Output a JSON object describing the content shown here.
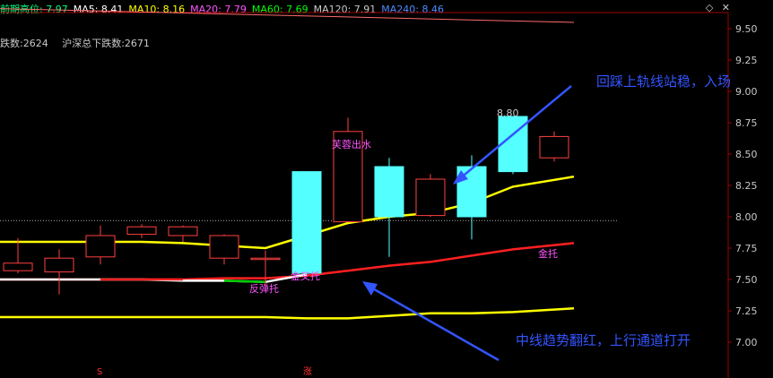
{
  "header": {
    "items": [
      {
        "label": "前期高位: 7.97",
        "color": "#00ff7f"
      },
      {
        "label": "MA5: 8.41",
        "color": "#ffffff"
      },
      {
        "label": "MA10: 8.16",
        "color": "#ffff00"
      },
      {
        "label": "MA20: 7.79",
        "color": "#ff55ff"
      },
      {
        "label": "MA60: 7.69",
        "color": "#00ff00"
      },
      {
        "label": "MA120: 7.91",
        "color": "#c8c8c8"
      },
      {
        "label": "MA240: 8.46",
        "color": "#4a8cff"
      }
    ],
    "icons": [
      "diamond-icon",
      "close-icon"
    ]
  },
  "subheader": {
    "left": "跌数:2624",
    "right": "沪深总下跌数:2671"
  },
  "chart_data": {
    "type": "candlestick",
    "ylim": [
      6.8,
      9.6
    ],
    "y_ticks": [
      "9.50",
      "9.25",
      "9.00",
      "8.75",
      "8.50",
      "8.25",
      "8.00",
      "7.75",
      "7.50",
      "7.25",
      "7.00"
    ],
    "candles": [
      {
        "open": 7.57,
        "close": 7.63,
        "high": 7.83,
        "low": 7.55
      },
      {
        "open": 7.56,
        "close": 7.67,
        "high": 7.74,
        "low": 7.38
      },
      {
        "open": 7.68,
        "close": 7.85,
        "high": 7.93,
        "low": 7.62
      },
      {
        "open": 7.86,
        "close": 7.92,
        "high": 7.94,
        "low": 7.83
      },
      {
        "open": 7.85,
        "close": 7.92,
        "high": 7.93,
        "low": 7.8
      },
      {
        "open": 7.67,
        "close": 7.85,
        "high": 7.86,
        "low": 7.62
      },
      {
        "open": 7.67,
        "close": 7.67,
        "high": 7.73,
        "low": 7.45
      },
      {
        "open": 8.36,
        "close": 7.55,
        "high": 8.36,
        "low": 7.55
      },
      {
        "open": 7.96,
        "close": 8.68,
        "high": 8.79,
        "low": 7.96
      },
      {
        "open": 8.4,
        "close": 8.0,
        "high": 8.47,
        "low": 7.68
      },
      {
        "open": 8.01,
        "close": 8.3,
        "high": 8.34,
        "low": 8.0
      },
      {
        "open": 8.4,
        "close": 8.0,
        "high": 8.49,
        "low": 7.82
      },
      {
        "open": 8.8,
        "close": 8.36,
        "high": 8.8,
        "low": 8.34
      },
      {
        "open": 8.47,
        "close": 8.64,
        "high": 8.68,
        "low": 8.44
      }
    ],
    "series": [
      {
        "color": "#ffff00",
        "values": [
          7.8,
          7.8,
          7.8,
          7.8,
          7.79,
          7.77,
          7.75,
          7.85,
          7.95,
          8.0,
          8.03,
          8.11,
          8.24,
          8.32
        ]
      },
      {
        "color": "#ff2020",
        "values": [
          7.5,
          7.5,
          7.5,
          7.5,
          7.5,
          7.51,
          7.51,
          7.53,
          7.57,
          7.61,
          7.64,
          7.69,
          7.74,
          7.79
        ]
      },
      {
        "color": "#ffff00",
        "values": [
          7.2,
          7.2,
          7.2,
          7.2,
          7.2,
          7.2,
          7.2,
          7.19,
          7.19,
          7.21,
          7.23,
          7.23,
          7.24,
          7.27
        ]
      }
    ],
    "white_segment": {
      "color": "#ffffff",
      "values": [
        7.5,
        7.5,
        7.5,
        7.5,
        7.49,
        7.49,
        7.48,
        7.54
      ]
    },
    "red_segment_idx": [
      2,
      3
    ],
    "green_segment_idx": [
      5,
      6
    ],
    "trend_line": {
      "color": "#ff6a6a",
      "values_start": 9.66,
      "values_end": 9.55
    },
    "reference_level": {
      "value": 7.97,
      "color": "#aaaaaa"
    },
    "annotations": [
      {
        "text": "芙蓉出水",
        "candle": 8,
        "y": 8.55,
        "color": "#ff55ff"
      },
      {
        "text": "反弹托",
        "candle": 6,
        "y": 7.4,
        "color": "#ff55ff"
      },
      {
        "text": "金叉托",
        "candle": 7,
        "y": 7.5,
        "color": "#ff55ff"
      },
      {
        "text": "金托",
        "candle": 13,
        "y": 7.68,
        "color": "#ff55ff"
      },
      {
        "text": "8.80",
        "candle": 12,
        "y": 8.8,
        "color": "#c8c8c8"
      }
    ],
    "callouts": [
      {
        "text": "回踩上轨线站稳，入场",
        "color": "#3355ff"
      },
      {
        "text": "中线趋势翻红，上行通道打开",
        "color": "#3355ff"
      }
    ],
    "bottom_marks": [
      {
        "text": "S",
        "candle": 2,
        "color": "#ff3030"
      },
      {
        "text": "涨",
        "candle": 7,
        "color": "#ff3030"
      }
    ]
  }
}
